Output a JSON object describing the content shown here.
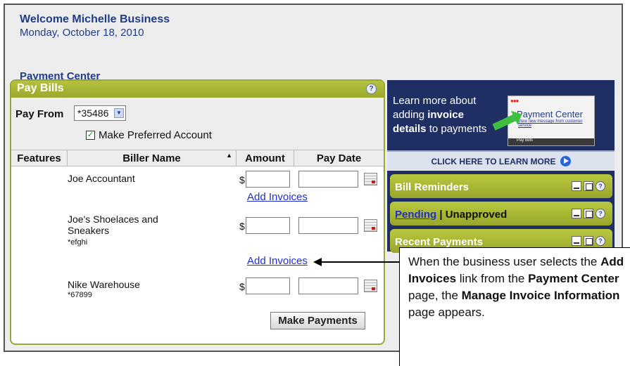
{
  "welcome": {
    "name": "Welcome Michelle Business",
    "date": "Monday, October 18, 2010"
  },
  "payment_center_title": "Payment Center",
  "pay_bills": {
    "title": "Pay Bills",
    "help_icon": "question-icon",
    "pay_from_label": "Pay From",
    "pay_from_value": "*35486",
    "preferred_label": "Make Preferred Account",
    "preferred_checked": true,
    "columns": [
      "Features",
      "Biller Name",
      "Amount",
      "Pay Date"
    ],
    "amount_prefix": "$",
    "add_invoices_label": "Add Invoices",
    "billers": [
      {
        "name": "Joe Accountant",
        "account": ""
      },
      {
        "name": "Joe's Shoelaces and Sneakers",
        "account": "*efghi"
      },
      {
        "name": "Nike Warehouse",
        "account": "*67899"
      }
    ],
    "make_payments_label": "Make Payments"
  },
  "learn_more": {
    "line1": "Learn more about",
    "line2a": "adding ",
    "line2b": "invoice",
    "line3a": "details",
    "line3b": " to payments",
    "mini_title": "Payment Center",
    "mini_link": "View new message from customer service",
    "mini_bar": "Pay Bills",
    "band_label": "CLICK HERE TO LEARN MORE"
  },
  "widgets": {
    "bill_reminders": "Bill Reminders",
    "pending": "Pending",
    "separator": " | ",
    "unapproved": "Unapproved",
    "recent_payments": "Recent Payments"
  },
  "callout": {
    "t1": "When the business user selects the ",
    "b1": "Add Invoices",
    "t2": " link from the ",
    "b2": "Payment Center",
    "t3": " page, the ",
    "b3": "Manage Invoice Information",
    "t4": " page appears."
  }
}
